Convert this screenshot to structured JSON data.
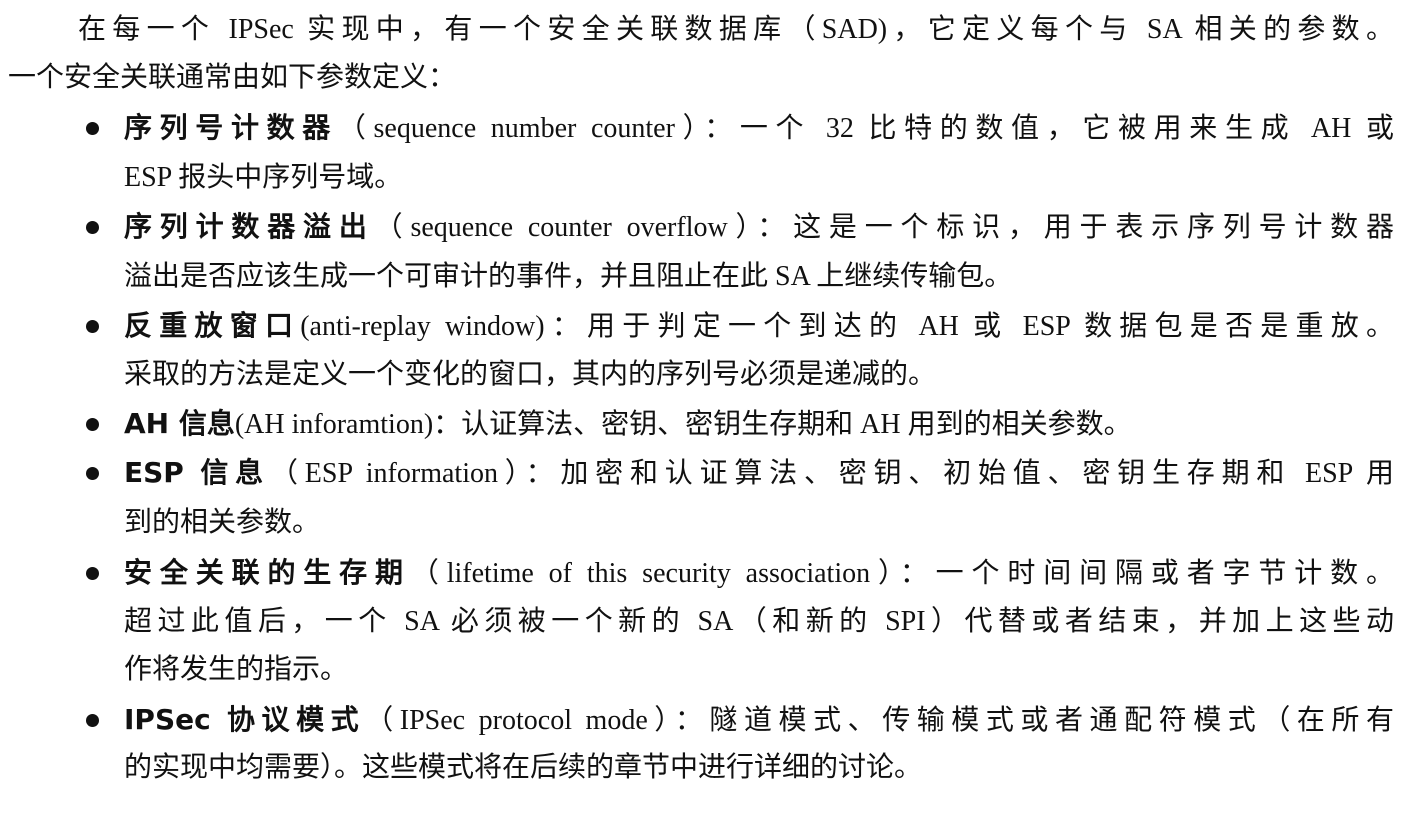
{
  "intro": {
    "line1": "在每一个 IPSec 实现中，有一个安全关联数据库（SAD)，它定义每个与 SA 相关的参数。",
    "line2": "一个安全关联通常由如下参数定义："
  },
  "items": [
    {
      "term": "序列号计数器",
      "lines": [
        "（sequence number counter）：一个 32 比特的数值，它被用来生成 AH 或",
        "ESP 报头中序列号域。"
      ]
    },
    {
      "term": "序列计数器溢出",
      "lines": [
        "（sequence counter overflow）：这是一个标识，用于表示序列号计数器",
        "溢出是否应该生成一个可审计的事件，并且阻止在此 SA 上继续传输包。"
      ]
    },
    {
      "term": "反重放窗口",
      "lines": [
        "(anti-replay window)：用于判定一个到达的 AH 或 ESP 数据包是否是重放。",
        "采取的方法是定义一个变化的窗口，其内的序列号必须是递减的。"
      ]
    },
    {
      "term": "AH 信息",
      "lines": [
        "(AH inforamtion)：认证算法、密钥、密钥生存期和 AH 用到的相关参数。"
      ]
    },
    {
      "term": "ESP 信息",
      "lines": [
        "（ESP information）：加密和认证算法、密钥、初始值、密钥生存期和 ESP 用",
        "到的相关参数。"
      ]
    },
    {
      "term": "安全关联的生存期",
      "lines": [
        "（lifetime of this security association）：一个时间间隔或者字节计数。",
        "超过此值后，一个 SA 必须被一个新的 SA（和新的 SPI）代替或者结束，并加上这些动",
        "作将发生的指示。"
      ]
    },
    {
      "term": "IPSec 协议模式",
      "lines": [
        "（IPSec protocol mode）：隧道模式、传输模式或者通配符模式（在所有",
        "的实现中均需要）。这些模式将在后续的章节中进行详细的讨论。"
      ]
    }
  ]
}
